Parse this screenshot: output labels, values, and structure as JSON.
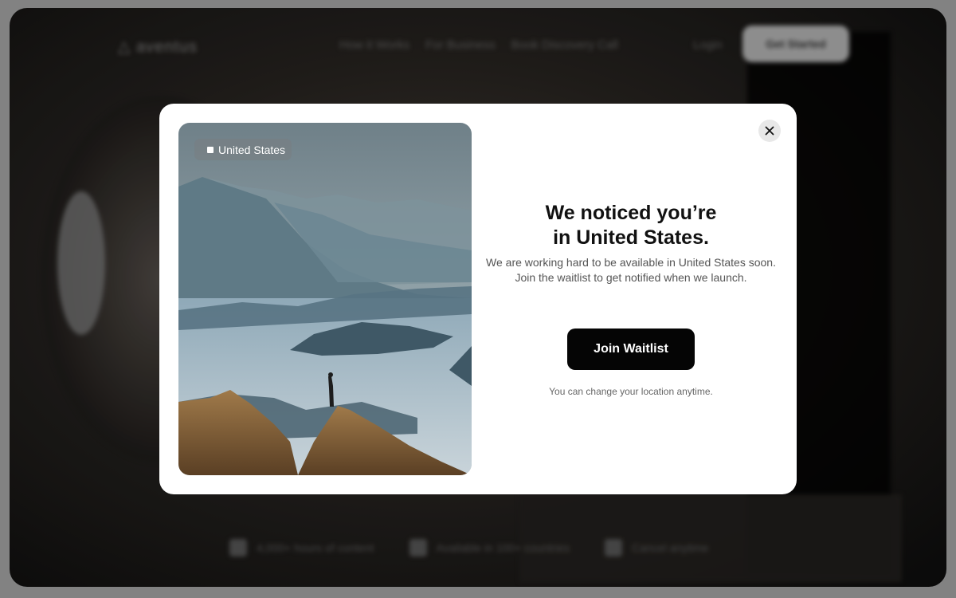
{
  "background": {
    "logo": "△ aventus",
    "nav_links": [
      "How it Works",
      "For Business",
      "Book Discovery Call"
    ],
    "login": "Login",
    "cta": "Get Started",
    "stats": [
      "4,000+ hours of content",
      "Available in 100+ countries",
      "Cancel anytime"
    ]
  },
  "modal": {
    "location_chip": "United States",
    "heading_line1": "We noticed you’re",
    "heading_line2": "in United States.",
    "subtext_line1": "We are working hard to be available in United States soon.",
    "subtext_line2": "Join the waitlist to get notified when we launch.",
    "join_button": "Join Waitlist",
    "hint": "You can change your location anytime.",
    "close_icon": "close-icon"
  },
  "colors": {
    "button_bg": "#050505",
    "modal_bg": "#ffffff",
    "overlay": "#8e8e8e"
  }
}
